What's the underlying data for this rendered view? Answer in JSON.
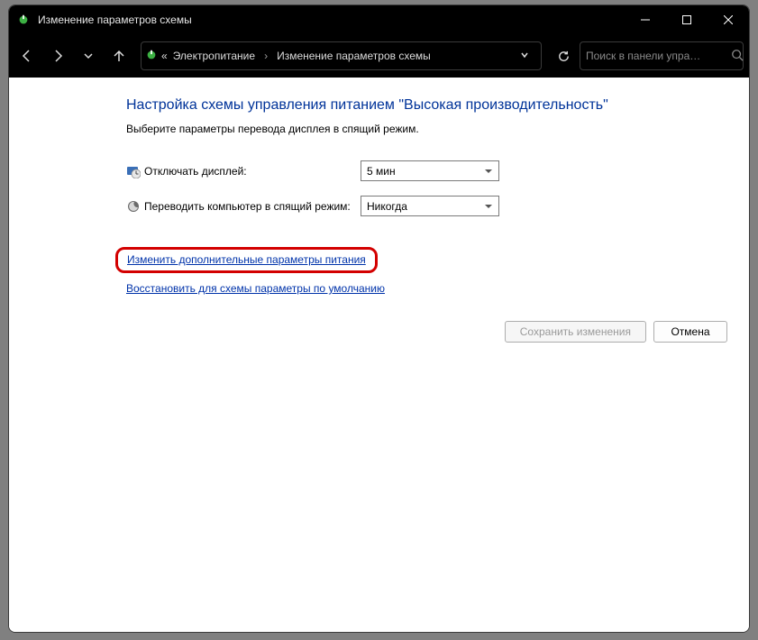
{
  "window": {
    "title": "Изменение параметров схемы"
  },
  "breadcrumb": {
    "prefix": "«",
    "item1": "Электропитание",
    "item2": "Изменение параметров схемы"
  },
  "search": {
    "placeholder": "Поиск в панели упра…"
  },
  "heading": "Настройка схемы управления питанием \"Высокая производительность\"",
  "subtext": "Выберите параметры перевода дисплея в спящий режим.",
  "rows": [
    {
      "label": "Отключать дисплей:",
      "value": "5 мин",
      "icon": "display-timeout-icon"
    },
    {
      "label": "Переводить компьютер в спящий режим:",
      "value": "Никогда",
      "icon": "sleep-icon"
    }
  ],
  "links": {
    "advanced": "Изменить дополнительные параметры питания",
    "restore": "Восстановить для схемы параметры по умолчанию"
  },
  "buttons": {
    "save": "Сохранить изменения",
    "cancel": "Отмена"
  }
}
